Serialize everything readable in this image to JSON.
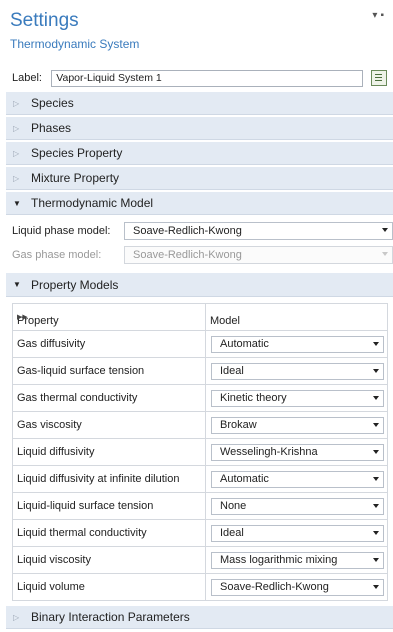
{
  "header": {
    "title": "Settings",
    "subtitle": "Thermodynamic System",
    "icons": [
      "pin-icon",
      "window-icon"
    ]
  },
  "label_field": {
    "label": "Label:",
    "value": "Vapor-Liquid System 1"
  },
  "sections_top": [
    {
      "label": "Species",
      "expanded": false
    },
    {
      "label": "Phases",
      "expanded": false
    },
    {
      "label": "Species Property",
      "expanded": false
    },
    {
      "label": "Mixture Property",
      "expanded": false
    },
    {
      "label": "Thermodynamic Model",
      "expanded": true
    }
  ],
  "thermo_model": {
    "liquid_label": "Liquid phase model:",
    "liquid_value": "Soave-Redlich-Kwong",
    "gas_label": "Gas phase model:",
    "gas_value": "Soave-Redlich-Kwong"
  },
  "property_models": {
    "label": "Property Models",
    "col_property": "Property",
    "col_model": "Model",
    "rows": [
      {
        "property": "Gas diffusivity",
        "model": "Automatic"
      },
      {
        "property": "Gas-liquid surface tension",
        "model": "Ideal"
      },
      {
        "property": "Gas thermal conductivity",
        "model": "Kinetic theory"
      },
      {
        "property": "Gas viscosity",
        "model": "Brokaw"
      },
      {
        "property": "Liquid diffusivity",
        "model": "Wesselingh-Krishna"
      },
      {
        "property": "Liquid diffusivity at infinite dilution",
        "model": "Automatic"
      },
      {
        "property": "Liquid-liquid surface tension",
        "model": "None"
      },
      {
        "property": "Liquid thermal conductivity",
        "model": "Ideal"
      },
      {
        "property": "Liquid viscosity",
        "model": "Mass logarithmic mixing"
      },
      {
        "property": "Liquid volume",
        "model": "Soave-Redlich-Kwong"
      }
    ]
  },
  "binary_section": {
    "label": "Binary Interaction Parameters"
  }
}
